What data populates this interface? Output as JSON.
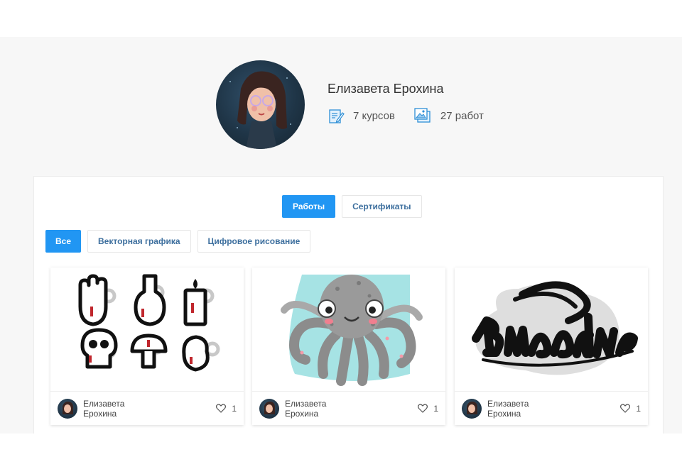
{
  "profile": {
    "name": "Елизавета Ерохина",
    "courses": "7 курсов",
    "works": "27 работ"
  },
  "tabs": [
    {
      "label": "Работы",
      "active": true
    },
    {
      "label": "Сертификаты",
      "active": false
    }
  ],
  "filters": [
    {
      "label": "Все",
      "active": true
    },
    {
      "label": "Векторная графика",
      "active": false
    },
    {
      "label": "Цифровое рисование",
      "active": false
    }
  ],
  "cards": [
    {
      "image": "halloween-icons-set",
      "author_first": "Елизавета",
      "author_last": "Ерохина",
      "likes": "1"
    },
    {
      "image": "octopus-illustration",
      "author_first": "Елизавета",
      "author_last": "Ерохина",
      "likes": "1"
    },
    {
      "image": "lettering-artwork",
      "author_first": "Елизавета",
      "author_last": "Ерохина",
      "likes": "1"
    }
  ],
  "colors": {
    "accent": "#2196f3",
    "link": "#3d6f9e",
    "background": "#f7f7f7"
  },
  "icons": {
    "courses": "notebook-pencil-icon",
    "works": "images-stack-icon",
    "like": "heart-icon"
  }
}
